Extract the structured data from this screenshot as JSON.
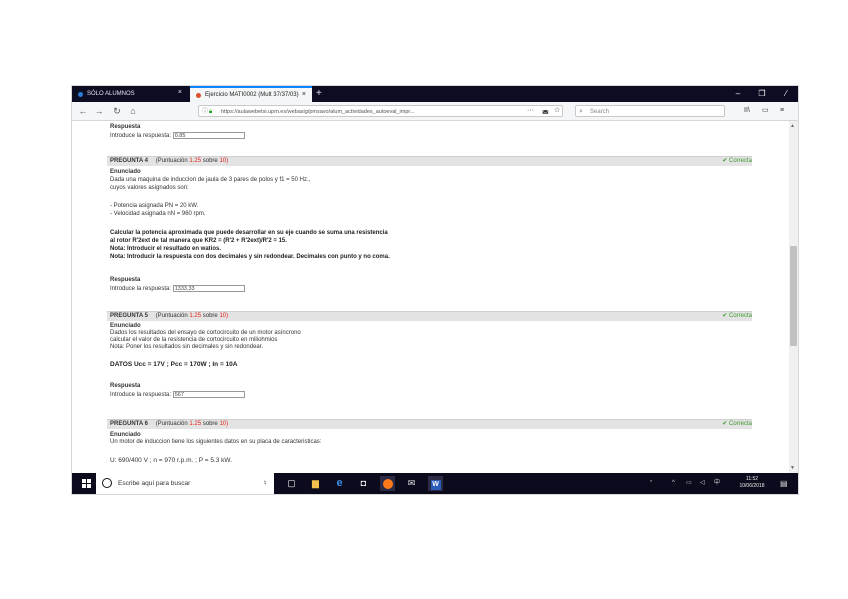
{
  "tabs": [
    {
      "label": "SÓLO ALUMNOS",
      "close": "×"
    },
    {
      "label": "Ejercicio MATI0002 (Mult 37/37/03)",
      "close": "×"
    }
  ],
  "new_tab": "+",
  "window_controls": {
    "minimize": "–",
    "maximize": "❐",
    "close": "⁄"
  },
  "nav": {
    "back": "←",
    "forward": "→",
    "reload": "↻",
    "home": "⌂",
    "url": "https://aulawebetsi.upm.es/webasig/pmsavo/alum_actividades_autoeval_impr...",
    "search_placeholder": "Search",
    "page_actions": "···",
    "pocket": "◛",
    "bookmark": "☆",
    "library": "II\\",
    "sidebar": "▭",
    "menu": "≡"
  },
  "content": {
    "top": {
      "respuesta_label": "Respuesta",
      "prompt": "Introduce la respuesta:",
      "answer": "0.85"
    },
    "q4": {
      "title": "PREGUNTA 4",
      "pts_prefix": "(Puntuación",
      "pts_value": "1.25",
      "pts_mid": "sobre",
      "pts_max": "10)",
      "status": "Correcta",
      "enunciado_label": "Enunciado",
      "lines": [
        "Dada una maquina de induccion de jaula de 3 pares de polos y f1 = 50 Hz.,",
        "cuyos valores asignados son:"
      ],
      "values": [
        "- Potencia asignada PN = 20 kW.",
        "- Velocidad asignada nN = 960 rpm."
      ],
      "bold_lines": [
        "Calcular la potencia aproximada que puede desarrollar en su eje cuando se suma una resistencia",
        "al rotor R'2ext de tal manera que KR2 = (R'2 + R'2ext)/R'2 = 15.",
        "Nota: Introducir el resultado en watios.",
        "Nota: Introducir la respuesta con dos decimales y sin redondear. Decimales con punto y no coma."
      ],
      "respuesta_label": "Respuesta",
      "prompt": "Introduce la respuesta:",
      "answer": "1333.33"
    },
    "q5": {
      "title": "PREGUNTA 5",
      "pts_prefix": "(Puntuación",
      "pts_value": "1.25",
      "pts_mid": "sobre",
      "pts_max": "10)",
      "status": "Correcta",
      "enunciado_label": "Enunciado",
      "lines": [
        "Dados los resultados del ensayo de cortocircuito de un motor asíncrono",
        "calcular el valor de la resistencia de cortocircuito en miliohmios",
        "Nota: Poner los resultados sin decimales y sin redondear."
      ],
      "datos": "DATOS Ucc = 17V ; Pcc = 170W ; In = 10A",
      "respuesta_label": "Respuesta",
      "prompt": "Introduce la respuesta:",
      "answer": "567"
    },
    "q6": {
      "title": "PREGUNTA 6",
      "pts_prefix": "(Puntuación",
      "pts_value": "1.25",
      "pts_mid": "sobre",
      "pts_max": "10)",
      "status": "Correcta",
      "enunciado_label": "Enunciado",
      "lines": [
        "Un motor de induccion tiene los siguientes datos en su placa de caracteristicas:"
      ],
      "datos": "U: 690/400 V ; n = 970 r.p.m. ; P = 5.3 kW."
    }
  },
  "taskbar": {
    "search_text": "Escribe aquí para buscar",
    "mic": "♮",
    "tray_icons": [
      "ᐢ",
      "^",
      "▭",
      "◁",
      "中"
    ],
    "time": "11:52",
    "date": "10/06/2018",
    "notifications": "▤"
  },
  "colors": {
    "tabbar": "#0c0c22",
    "taskbar": "#0b0b1d",
    "points_red": "#e0221a",
    "correct_green": "#3b9a2c",
    "question_header": "#e3e3e3",
    "accent_blue": "#0a84ff"
  }
}
